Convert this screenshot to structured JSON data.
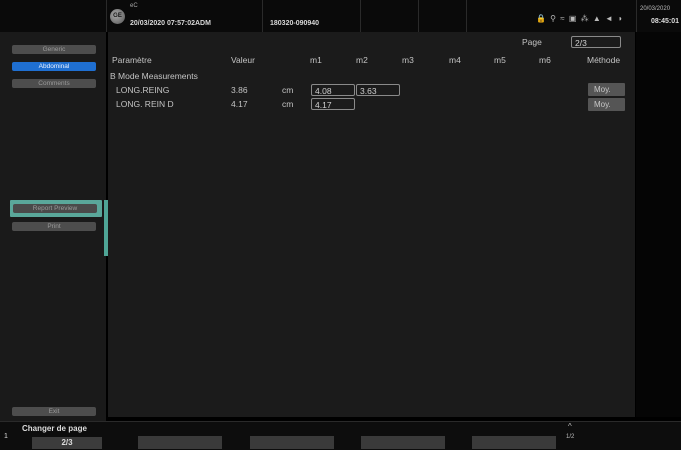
{
  "header": {
    "logo_text": "GE",
    "probe": "eC",
    "datetime": "20/03/2020 07:57:02ADM",
    "patient_id": "180320-090940",
    "status_icons": "🔒 ⚲ ≈ ▣ ⁂ ▲ ◄ ◑",
    "clock_date": "20/03/2020",
    "clock_time": "08:45:01"
  },
  "sidebar": {
    "items": [
      {
        "label": "Generic",
        "active": false
      },
      {
        "label": "Abdominal",
        "active": true
      },
      {
        "label": "Comments",
        "active": false
      }
    ],
    "report_preview": "Report Preview",
    "print": "Print",
    "exit": "Exit"
  },
  "callout": "C",
  "report": {
    "page_label": "Page",
    "page_value": "2/3",
    "headers": [
      "Paramètre",
      "Valeur",
      "",
      "m1",
      "m2",
      "m3",
      "m4",
      "m5",
      "m6",
      "Méthode"
    ],
    "section": "B Mode Measurements",
    "rows": [
      {
        "param": "LONG.REING",
        "value": "3.86",
        "unit": "cm",
        "m1": "4.08",
        "m2": "3.63",
        "method": "Moy."
      },
      {
        "param": "LONG. REIN D",
        "value": "4.17",
        "unit": "cm",
        "m1": "4.17",
        "m2": "",
        "method": "Moy."
      }
    ]
  },
  "bottom": {
    "page_num": "1",
    "changer_label": "Changer de page",
    "changer_value": "2/3",
    "caret": "^",
    "page": "1/2"
  },
  "colors": {
    "accent_blue": "#1f6fd1",
    "callout_teal": "#4fa596"
  }
}
